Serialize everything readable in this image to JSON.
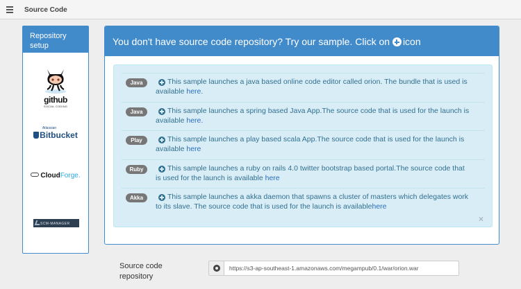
{
  "topbar": {
    "title": "Source Code",
    "menu_icon": "list-icon"
  },
  "sidebar": {
    "title": "Repository setup",
    "providers": [
      {
        "name": "github",
        "logo_text": "github",
        "logo_subtext": "SOCIAL CODING",
        "icon": "octocat-icon"
      },
      {
        "name": "bitbucket",
        "logo_small": "Atlassian",
        "logo_text": "Bitbucket",
        "icon": "bitbucket-icon"
      },
      {
        "name": "cloudforge",
        "logo_text_a": "Cloud",
        "logo_text_b": "Forge",
        "logo_dot": ".",
        "icon": "cloud-icon"
      },
      {
        "name": "scmmanager",
        "logo_text": "SCM-MANAGER",
        "icon": "scm-icon"
      }
    ]
  },
  "panel": {
    "heading_prefix": "You don't have source code repository? Try our sample. Click on",
    "heading_suffix": "icon",
    "samples": [
      {
        "badge": "Java",
        "text": "This sample launches a java based online code editor called orion. The bundle that is used is available",
        "link": "here."
      },
      {
        "badge": "Java",
        "text": "This sample launches a spring based Java App.The source code that is used for the launch is available",
        "link": "here."
      },
      {
        "badge": "Play",
        "text": "This sample launches a play based scala App.The source code that is used for the launch is available",
        "link": "here"
      },
      {
        "badge": "Ruby",
        "text": "This sample launches a ruby on rails 4.0 twitter bootstrap based portal.The source code that is used for the launch is available",
        "link": "here"
      },
      {
        "badge": "Akka",
        "text": "This sample launches a akka daemon that spawns a cluster of masters which delegates work to its slave. The source code that is used for the launch is available",
        "link": "here"
      }
    ],
    "close": "×"
  },
  "source": {
    "label": "Source code repository",
    "value": "https://s3-ap-southeast-1.amazonaws.com/megampub/0.1/war/orion.war"
  },
  "colors": {
    "primary": "#428bca",
    "alert_bg": "#d9edf7",
    "alert_text": "#31708f",
    "badge": "#777777"
  }
}
